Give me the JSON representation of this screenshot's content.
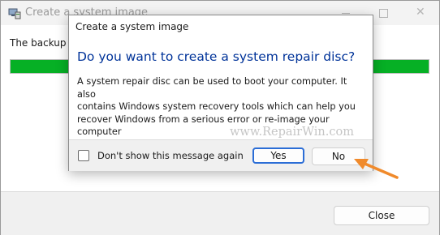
{
  "background_window": {
    "title": "Create a system image",
    "icon": "system-image-icon",
    "window_controls": {
      "minimize_icon": "minimize-icon",
      "maximize_icon": "maximize-icon",
      "close_icon": "close-icon"
    },
    "status_text": "The backup c",
    "progress": {
      "fraction": 1.0,
      "color": "#06b025"
    },
    "close_button_label": "Close"
  },
  "dialog": {
    "title": "Create a system image",
    "heading": "Do you want to create a system repair disc?",
    "body": "A system repair disc can be used to boot your computer. It also\ncontains Windows system recovery tools which can help you\nrecover Windows from a serious error or re-image your computer\nfrom a system image.",
    "checkbox_label": "Don't show this message again",
    "checkbox_checked": false,
    "yes_label": "Yes",
    "no_label": "No",
    "heading_color": "#003399",
    "focus_color": "#2b6dd6"
  },
  "watermark": "www.RepairWin.com",
  "annotation": {
    "color": "#f08a2b",
    "icon": "pointer-arrow-icon"
  }
}
